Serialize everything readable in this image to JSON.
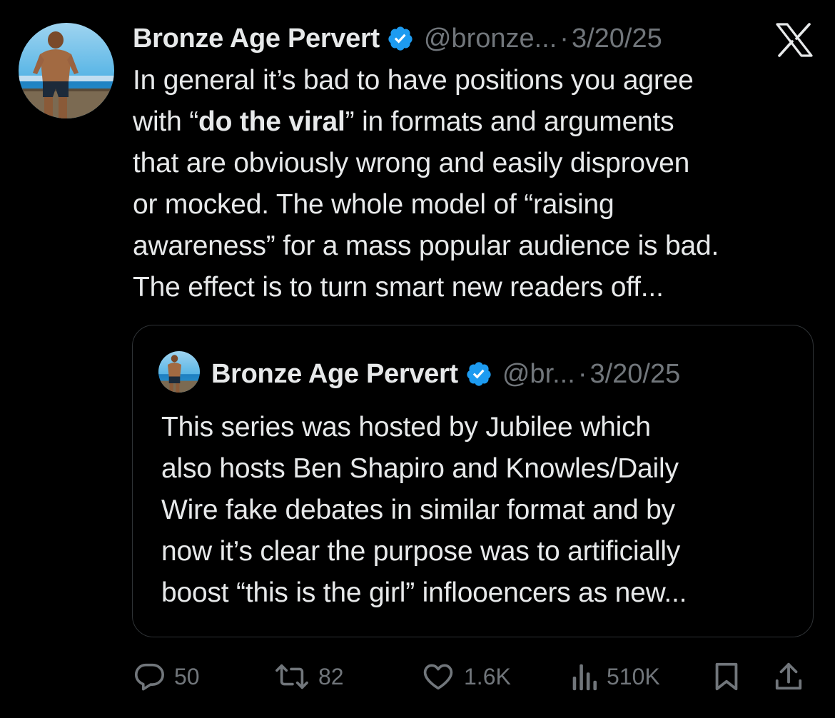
{
  "tweet": {
    "author": {
      "display_name": "Bronze Age Pervert",
      "handle": "@bronze...",
      "verified": true
    },
    "separator": "·",
    "date": "3/20/25",
    "text_lines": [
      [
        "In general it’s bad to have positions you agree"
      ],
      [
        "with “",
        "do the viral",
        "” in formats and arguments"
      ],
      [
        "that are obviously wrong and easily disproven"
      ],
      [
        "or mocked. The whole model of “raising"
      ],
      [
        "awareness” for a mass popular audience is bad."
      ],
      [
        "The effect is to turn smart new readers off..."
      ]
    ],
    "text": {
      "line1": "In general it’s bad to have positions you agree",
      "line2_pre": "with “",
      "line2_bold": "do the viral",
      "line2_post": "” in formats and arguments",
      "line3": "that are obviously wrong and easily disproven",
      "line4": "or mocked. The whole model of “raising",
      "line5": "awareness” for a mass popular audience is bad.",
      "line6": "The effect is to turn smart new readers off..."
    }
  },
  "platform_logo": "x-logo",
  "quoted_tweet": {
    "author": {
      "display_name": "Bronze Age Pervert",
      "handle": "@br...",
      "verified": true
    },
    "separator": "·",
    "date": "3/20/25",
    "text": {
      "line1": "This series was hosted by Jubilee which",
      "line2": "also hosts Ben Shapiro and Knowles/Daily",
      "line3": "Wire fake debates in similar format and by",
      "line4": "now it’s clear the purpose was to artificially",
      "line5": "boost “this is the girl” inflooencers as new..."
    }
  },
  "actions": {
    "replies": "50",
    "retweets": "82",
    "likes": "1.6K",
    "views": "510K",
    "icons": [
      "reply-icon",
      "retweet-icon",
      "like-icon",
      "views-icon",
      "bookmark-icon",
      "share-icon"
    ]
  },
  "colors": {
    "background": "#000000",
    "text_primary": "#e7e9ea",
    "text_secondary": "#71767b",
    "verified_blue": "#1d9bf0",
    "border": "#2f3336"
  }
}
